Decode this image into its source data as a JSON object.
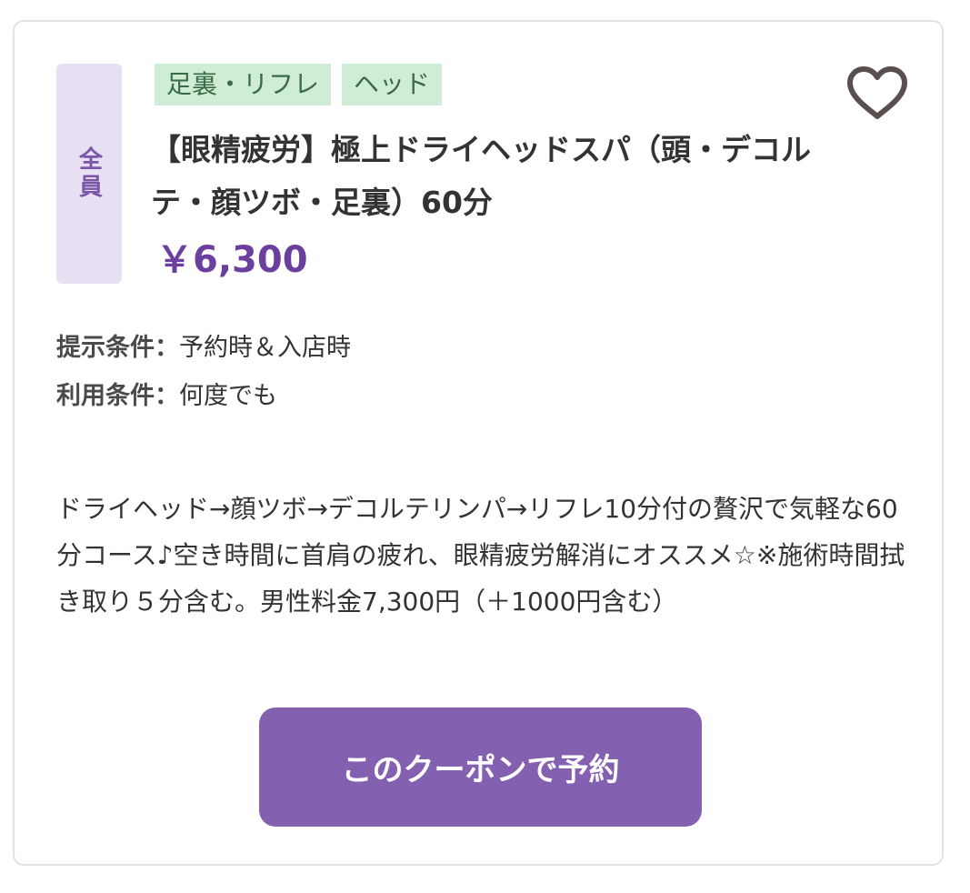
{
  "coupon": {
    "target": "全員",
    "tags": [
      "足裏・リフレ",
      "ヘッド"
    ],
    "title": "【眼精疲労】極上ドライヘッドスパ（頭・デコルテ・顔ツボ・足裏）60分",
    "price": "￥6,300",
    "conditions": [
      {
        "label": "提示条件：",
        "value": "予約時＆入店時"
      },
      {
        "label": "利用条件：",
        "value": "何度でも"
      }
    ],
    "description": "ドライヘッド→顔ツボ→デコルテリンパ→リフレ10分付の贅沢で気軽な60分コース♪空き時間に首肩の疲れ、眼精疲労解消にオススメ☆※施術時間拭き取り５分含む。男性料金7,300円（＋1000円含む）",
    "reserve_label": "このクーポンで予約"
  },
  "colors": {
    "accent": "#8460b0",
    "price": "#6b3f9e",
    "tag_bg": "#cfecd6",
    "badge_bg": "#e7e0f3",
    "heart": "#5a4f4f"
  },
  "icons": {
    "favorite": "heart-outline-icon"
  }
}
